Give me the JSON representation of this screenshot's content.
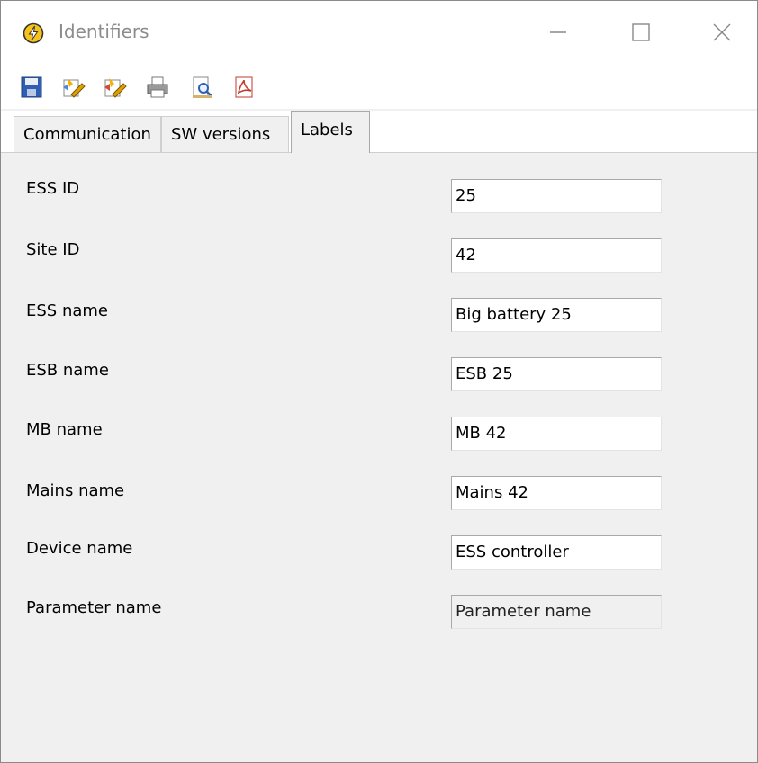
{
  "window": {
    "title": "Identifiers"
  },
  "toolbar": {
    "items": [
      {
        "icon": "save-icon"
      },
      {
        "icon": "edit-icon"
      },
      {
        "icon": "edit-alt-icon"
      },
      {
        "icon": "print-icon"
      },
      {
        "icon": "print-preview-icon"
      },
      {
        "icon": "export-pdf-icon"
      }
    ]
  },
  "tabs": [
    {
      "label": "Communication",
      "active": false
    },
    {
      "label": "SW versions",
      "active": false
    },
    {
      "label": "Labels",
      "active": true
    }
  ],
  "fields": [
    {
      "label": "ESS ID",
      "value": "25"
    },
    {
      "label": "Site ID",
      "value": "42"
    },
    {
      "label": "ESS name",
      "value": "Big battery 25"
    },
    {
      "label": "ESB name",
      "value": "ESB 25"
    },
    {
      "label": "MB name",
      "value": "MB 42"
    },
    {
      "label": "Mains name",
      "value": "Mains 42"
    },
    {
      "label": "Device name",
      "value": "ESS controller"
    },
    {
      "label": "Parameter name",
      "value": "Parameter name",
      "readonly": true
    }
  ],
  "colors": {
    "accent_icon": "#f2b200",
    "title_text": "#8c8c8c",
    "panel_bg": "#f0f0f0"
  }
}
